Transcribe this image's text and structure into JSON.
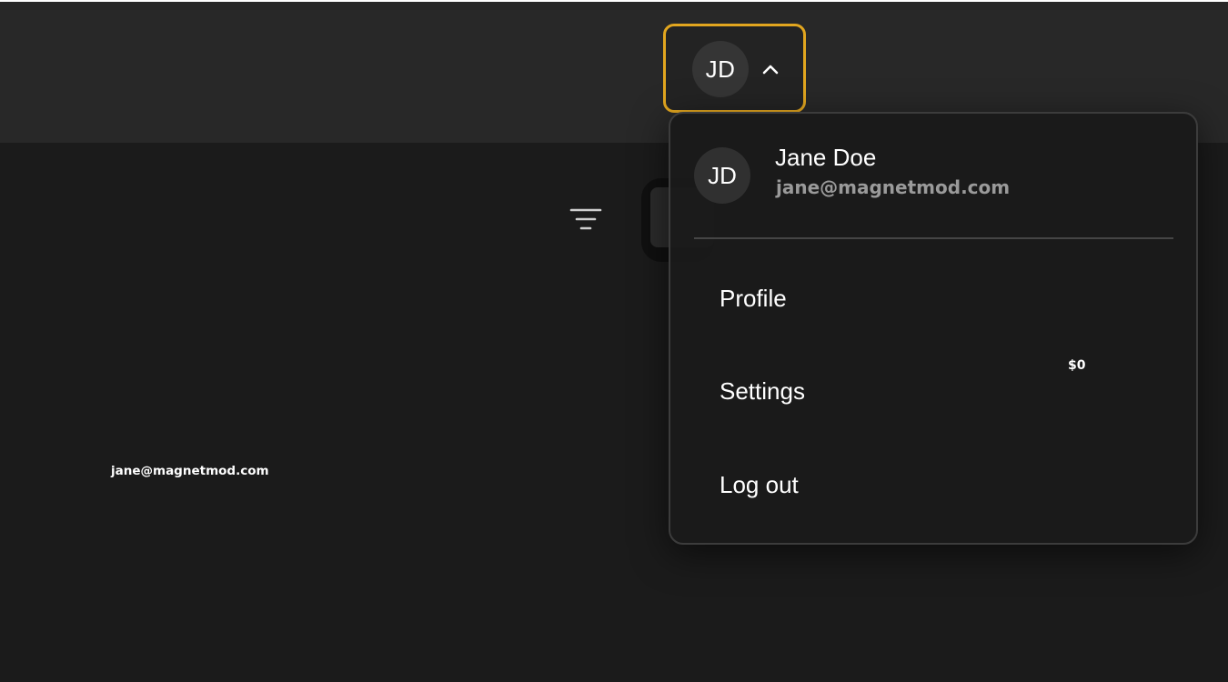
{
  "header": {
    "avatar_initials": "JD",
    "chevron_icon": "chevron-up-icon"
  },
  "toolbar": {
    "filter_icon": "filter-icon"
  },
  "background": {
    "email": "jane@magnetmod.com",
    "amount": "$0"
  },
  "dropdown": {
    "user": {
      "initials": "JD",
      "name": "Jane Doe",
      "email": "jane@magnetmod.com"
    },
    "items": [
      {
        "label": "Profile"
      },
      {
        "label": "Settings"
      },
      {
        "label": "Log out"
      }
    ]
  },
  "colors": {
    "accent": "#e2a61f",
    "topbar": "#282828",
    "background": "#1b1b1b",
    "dropdown_bg": "#1a1a1a",
    "muted_text": "#9a9a9a"
  }
}
